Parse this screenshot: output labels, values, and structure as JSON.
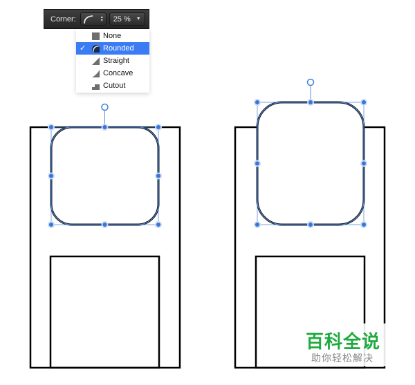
{
  "toolbar": {
    "corner_label": "Corner:",
    "corner_style_icon": "rounded-corner-icon",
    "corner_radius_value": "25 %"
  },
  "corner_menu": {
    "items": [
      {
        "label": "None",
        "icon": "none-corner-icon",
        "selected": false
      },
      {
        "label": "Rounded",
        "icon": "rounded-corner-icon",
        "selected": true
      },
      {
        "label": "Straight",
        "icon": "straight-corner-icon",
        "selected": false
      },
      {
        "label": "Concave",
        "icon": "concave-corner-icon",
        "selected": false
      },
      {
        "label": "Cutout",
        "icon": "cutout-corner-icon",
        "selected": false
      }
    ],
    "check_glyph": "✓"
  },
  "colors": {
    "selection_blue": "#3b7cf4",
    "handle_blue": "#2f6fd6",
    "shape_stroke": "#0d1a33"
  },
  "watermark": {
    "title": "百科全说",
    "subtitle": "助你轻松解决"
  }
}
